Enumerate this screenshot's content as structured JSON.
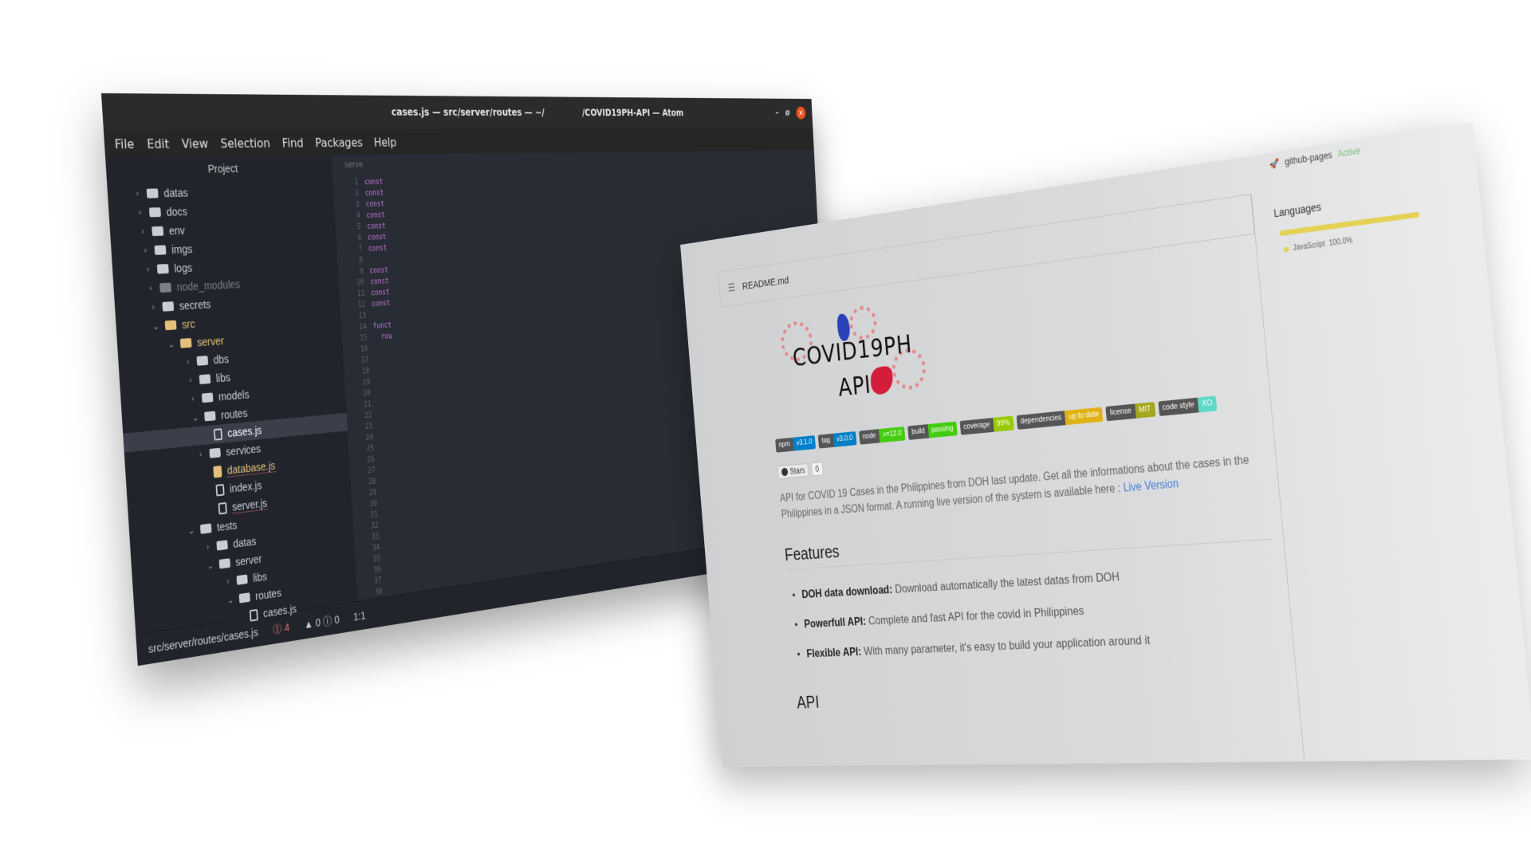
{
  "atom": {
    "title_left": "cases.js — src/server/routes — ~/",
    "title_right": "/COVID19PH-API — Atom",
    "window_controls": {
      "minimize": "–",
      "maximize": "ø",
      "close": "✕"
    },
    "menu": [
      "File",
      "Edit",
      "View",
      "Selection",
      "Find",
      "Packages",
      "Help"
    ],
    "tree_header": "Project",
    "tree": [
      {
        "label": "datas",
        "type": "folder"
      },
      {
        "label": "docs",
        "type": "folder"
      },
      {
        "label": "env",
        "type": "folder"
      },
      {
        "label": "imgs",
        "type": "folder"
      },
      {
        "label": "logs",
        "type": "folder"
      },
      {
        "label": "node_modules",
        "type": "folder"
      },
      {
        "label": "secrets",
        "type": "folder"
      },
      {
        "label": "src",
        "type": "folder"
      },
      {
        "label": "server",
        "type": "folder"
      },
      {
        "label": "dbs",
        "type": "folder"
      },
      {
        "label": "libs",
        "type": "folder"
      },
      {
        "label": "models",
        "type": "folder"
      },
      {
        "label": "routes",
        "type": "folder"
      },
      {
        "label": "cases.js",
        "type": "file"
      },
      {
        "label": "services",
        "type": "folder"
      },
      {
        "label": "database.js",
        "type": "file"
      },
      {
        "label": "index.js",
        "type": "file"
      },
      {
        "label": "server.js",
        "type": "file"
      },
      {
        "label": "tests",
        "type": "folder"
      },
      {
        "label": "datas",
        "type": "folder"
      },
      {
        "label": "server",
        "type": "folder"
      },
      {
        "label": "libs",
        "type": "folder"
      },
      {
        "label": "routes",
        "type": "folder"
      },
      {
        "label": "cases.js",
        "type": "file"
      }
    ],
    "editor_tab": "serve",
    "line_numbers": "1\n2\n3\n4\n5\n6\n7\n8\n9\n10\n11\n12\n13\n14\n15\n16\n17\n18\n19\n20\n21\n22\n23\n24\n25\n26\n27\n28\n29\n30\n31\n32\n33\n34\n35\n36\n37\n38",
    "code_lines": "const\nconst\nconst\nconst\nconst\nconst\nconst\n\nconst\nconst\nconst\nconst\n\nfunct\n  rou",
    "status": {
      "path": "src/server/routes/cases.js",
      "errors": "4",
      "warnings": "0",
      "infos": "0",
      "cursor": "1:1"
    }
  },
  "readme": {
    "file_title": "README.md",
    "logo": {
      "line1": "COVID19PH",
      "line2": "API"
    },
    "badges": [
      {
        "key": "npm",
        "value": "v3.1.0",
        "color": "#007ec6"
      },
      {
        "key": "tag",
        "value": "v3.0.0",
        "color": "#007ec6"
      },
      {
        "key": "node",
        "value": ">=12.0",
        "color": "#44cc11"
      },
      {
        "key": "build",
        "value": "passing",
        "color": "#44cc11"
      },
      {
        "key": "coverage",
        "value": "99%",
        "color": "#97ca00"
      },
      {
        "key": "dependencies",
        "value": "up to date",
        "color": "#dfb317"
      },
      {
        "key": "license",
        "value": "MIT",
        "color": "#a4a61d"
      },
      {
        "key": "code style",
        "value": "XO",
        "color": "#5ed9c7"
      }
    ],
    "stars_label": "Stars",
    "stars_count": "0",
    "description": "API for COVID 19 Cases in the Philippines from DOH last update. Get all the informations about the cases in the Philippines in a JSON format. A running live version of the system is available here :",
    "live_link": "Live Version",
    "features_heading": "Features",
    "features": [
      {
        "name": "DOH data download:",
        "text": "Download automatically the latest datas from DOH"
      },
      {
        "name": "Powerfull API:",
        "text": "Complete and fast API for the covid in Philippines"
      },
      {
        "name": "Flexible API:",
        "text": "With many parameter, it's easy to build your application around it"
      }
    ],
    "api_heading": "API",
    "sidebar": {
      "deploy": "github-pages",
      "deploy_status": "Active",
      "languages_heading": "Languages",
      "language": "JavaScript",
      "language_pct": "100.0%",
      "language_color": "#e3d255"
    }
  }
}
